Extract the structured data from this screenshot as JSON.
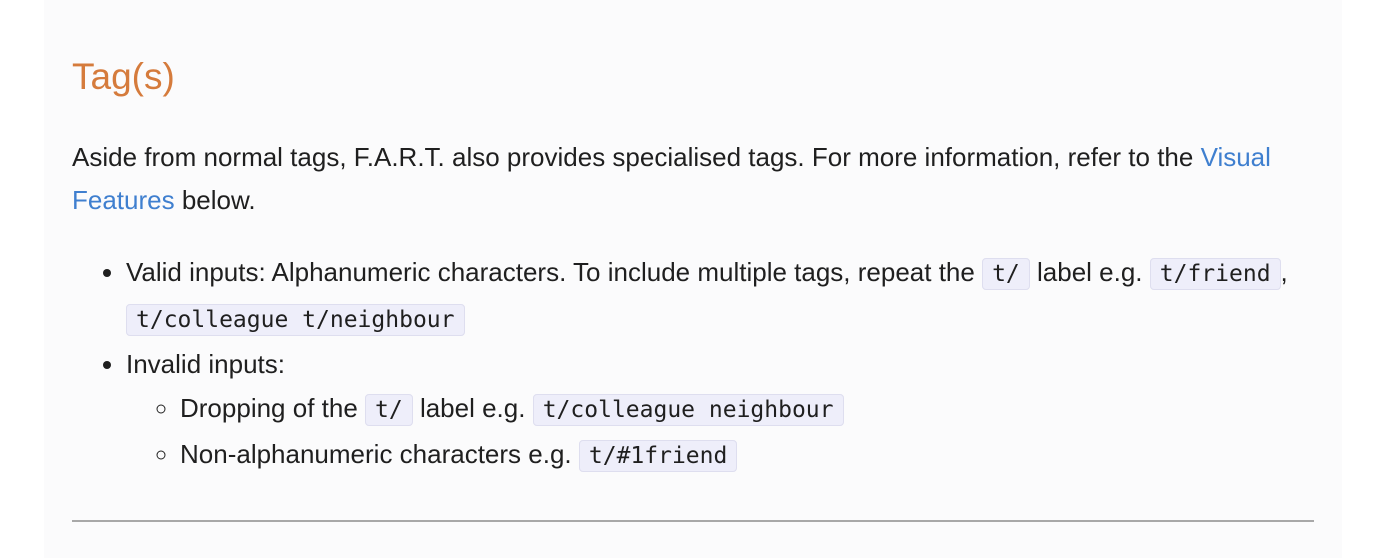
{
  "section": {
    "title": "Tag(s)"
  },
  "intro": {
    "text_before": "Aside from normal tags, F.A.R.T. also provides specialised tags. For more information, refer to the ",
    "link_label": "Visual Features",
    "text_after": " below."
  },
  "valid": {
    "text_before": "Valid inputs: Alphanumeric characters. To include multiple tags, repeat the ",
    "code_label": "t/",
    "text_mid": " label e.g. ",
    "example_1": "t/friend",
    "separator": ", ",
    "example_2": "t/colleague t/neighbour"
  },
  "invalid": {
    "label": "Invalid inputs:",
    "items": [
      {
        "text_before": "Dropping of the ",
        "code_label": "t/",
        "text_mid": " label e.g. ",
        "example": "t/colleague neighbour"
      },
      {
        "text_before": "Non-alphanumeric characters e.g. ",
        "example": "t/#1friend"
      }
    ]
  }
}
